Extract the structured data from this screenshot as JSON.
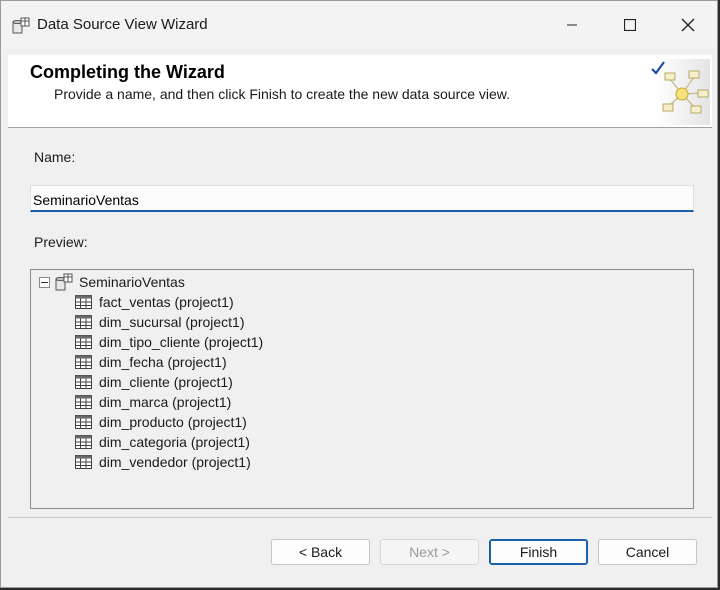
{
  "window": {
    "title": "Data Source View Wizard"
  },
  "banner": {
    "title": "Completing the Wizard",
    "subtitle": "Provide a name, and then click Finish to create the new data source view."
  },
  "form": {
    "name_label": "Name:",
    "name_value": "SeminarioVentas",
    "preview_label": "Preview:"
  },
  "preview": {
    "root": "SeminarioVentas",
    "items": [
      "fact_ventas (project1)",
      "dim_sucursal (project1)",
      "dim_tipo_cliente (project1)",
      "dim_fecha (project1)",
      "dim_cliente (project1)",
      "dim_marca (project1)",
      "dim_producto (project1)",
      "dim_categoria (project1)",
      "dim_vendedor (project1)"
    ]
  },
  "buttons": {
    "back": "< Back",
    "next": "Next >",
    "finish": "Finish",
    "cancel": "Cancel"
  },
  "colors": {
    "accent": "#1b5fa8",
    "window_bg": "#f0f0f0"
  }
}
